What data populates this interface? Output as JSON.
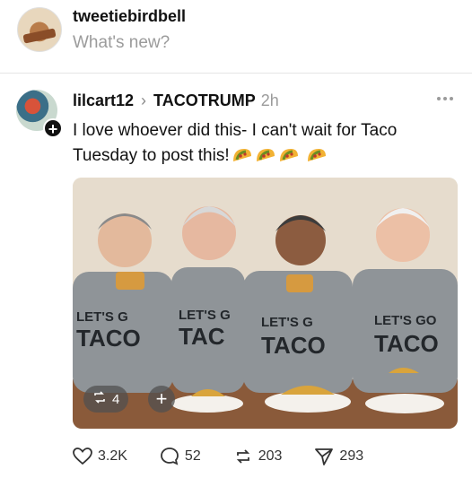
{
  "composer": {
    "username": "tweetiebirdbell",
    "placeholder": "What's new?"
  },
  "post": {
    "username": "lilcart12",
    "chevron": "›",
    "topic": "TACOTRUMP",
    "time": "2h",
    "text": "I love whoever did this- I can't wait for Taco Tuesday to post this!",
    "emoji_icons": [
      "taco-emoji",
      "taco-emoji",
      "taco-emoji",
      "taco-emoji"
    ],
    "follow_symbol": "+",
    "media": {
      "shirt_texts": [
        "LET'S G",
        "TACO",
        "LET'S G",
        "TAC",
        "LET'S G",
        "TACO",
        "LET'S GO",
        "TACO"
      ],
      "repost_count": "4",
      "plus_symbol": "+"
    },
    "actions": {
      "likes": "3.2K",
      "comments": "52",
      "reposts": "203",
      "shares": "293"
    }
  }
}
